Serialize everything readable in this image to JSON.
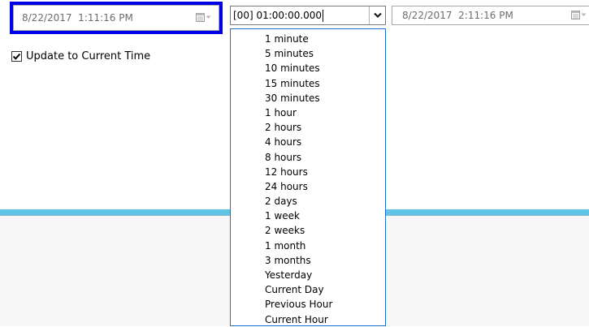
{
  "start_picker": {
    "date": "8/22/2017",
    "time": "1:11:16 PM"
  },
  "duration": {
    "value": "[00] 01:00:00.000",
    "options": [
      "1 minute",
      "5 minutes",
      "10 minutes",
      "15 minutes",
      "30 minutes",
      "1 hour",
      "2 hours",
      "4 hours",
      "8 hours",
      "12 hours",
      "24 hours",
      "2 days",
      "1 week",
      "2 weeks",
      "1 month",
      "3 months",
      "Yesterday",
      "Current Day",
      "Previous Hour",
      "Current Hour"
    ]
  },
  "end_picker": {
    "date": "8/22/2017",
    "time": "2:11:16 PM"
  },
  "update_option": {
    "label": "Update to Current Time",
    "checked": true
  },
  "icons": {
    "calendar": "calendar-icon",
    "dropdown": "chevron-down-icon",
    "check": "checkmark-icon"
  },
  "colors": {
    "focus_border": "#0000e6",
    "separator": "#5fc4e6",
    "list_border": "#1e6fd0"
  }
}
